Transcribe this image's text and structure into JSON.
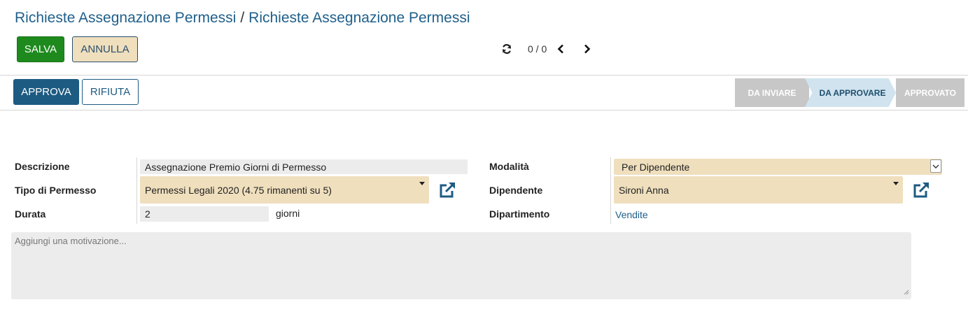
{
  "breadcrumb": {
    "parent": "Richieste Assegnazione Permessi",
    "separator": "/",
    "current": "Richieste Assegnazione Permessi"
  },
  "toolbar": {
    "save_label": "SALVA",
    "discard_label": "ANNULLA"
  },
  "pager": {
    "value": "0 / 0"
  },
  "actions": {
    "approve_label": "APPROVA",
    "refuse_label": "RIFIUTA"
  },
  "statusbar": {
    "stages": [
      "DA INVIARE",
      "DA APPROVARE",
      "APPROVATO"
    ],
    "active": "DA APPROVARE"
  },
  "form": {
    "description_label": "Descrizione",
    "description_value": "Assegnazione Premio Giorni di Permesso",
    "leave_type_label": "Tipo di Permesso",
    "leave_type_value": "Permessi Legali 2020 (4.75 rimanenti su 5)",
    "duration_label": "Durata",
    "duration_value": "2",
    "duration_unit": "giorni",
    "mode_label": "Modalità",
    "mode_value": "Per Dipendente",
    "employee_label": "Dipendente",
    "employee_value": "Sironi Anna",
    "department_label": "Dipartimento",
    "department_value": "Vendite",
    "reason_placeholder": "Aggiungi una  motivazione..."
  },
  "icons": {
    "refresh": "refresh-icon",
    "prev": "chevron-left-icon",
    "next": "chevron-right-icon",
    "external": "external-link-icon"
  },
  "colors": {
    "primary": "#1d5b82",
    "save": "#1e8a1e",
    "required_field": "#efdfbd"
  }
}
